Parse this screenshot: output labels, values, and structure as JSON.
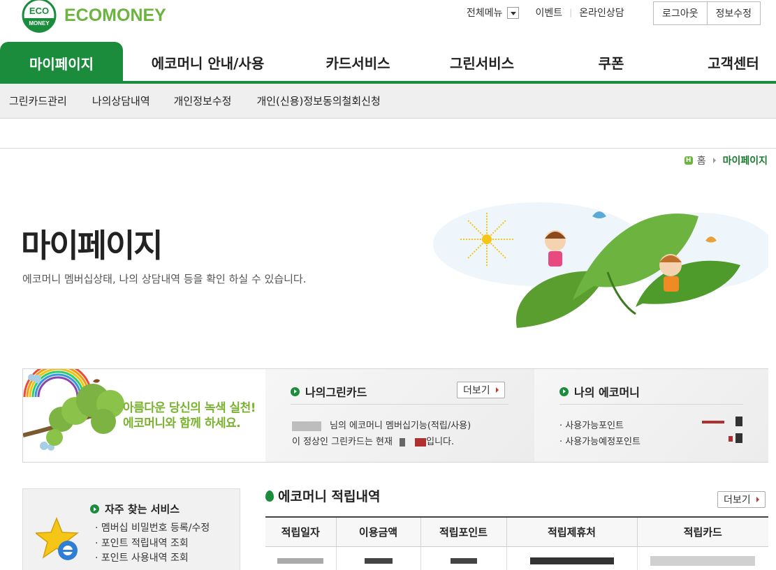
{
  "brand": {
    "logo_circle_top": "ECO",
    "logo_circle_bottom": "MONEY",
    "logo_text": "ECOMONEY"
  },
  "top_links": {
    "all_menu": "전체메뉴",
    "event": "이벤트",
    "consult": "온라인상담"
  },
  "top_buttons": {
    "logout": "로그아웃",
    "edit_info": "정보수정"
  },
  "gnb": [
    {
      "label": "마이페이지",
      "active": true
    },
    {
      "label": "에코머니 안내/사용"
    },
    {
      "label": "카드서비스"
    },
    {
      "label": "그린서비스"
    },
    {
      "label": "쿠폰"
    },
    {
      "label": "고객센터"
    }
  ],
  "subnav": [
    "그린카드관리",
    "나의상담내역",
    "개인정보수정",
    "개인(신용)정보동의철회신청"
  ],
  "breadcrumb": {
    "home_icon": "H",
    "home": "홈",
    "current": "마이페이지"
  },
  "hero": {
    "title": "마이페이지",
    "desc": "에코머니 멤버십상태, 나의 상담내역 등을 확인 하실 수 있습니다."
  },
  "promo": {
    "line1": "아름다운 당신의 녹색 실천!",
    "line2": "에코머니와 함께 하세요."
  },
  "green_card": {
    "title": "나의그린카드",
    "more": "더보기",
    "line1": "님의 에코머니 멤버십기능(적립/사용)",
    "line2_prefix": "이 정상인 그린카드는 현재",
    "line2_suffix": "입니다."
  },
  "my_ecomoney": {
    "title": "나의 에코머니",
    "items": [
      "사용가능포인트",
      "사용가능예정포인트"
    ]
  },
  "frequent": {
    "title": "자주 찾는 서비스",
    "items": [
      "멤버십 비밀번호 등록/수정",
      "포인트 적립내역 조회",
      "포인트 사용내역 조회"
    ]
  },
  "accrual": {
    "title": "에코머니 적립내역",
    "more": "더보기",
    "columns": [
      "적립일자",
      "이용금액",
      "적립포인트",
      "적립제휴처",
      "적립카드"
    ]
  },
  "colors": {
    "brand_green": "#1a8c3c",
    "light_green": "#7ab32f",
    "accent_red": "#c0392b"
  }
}
